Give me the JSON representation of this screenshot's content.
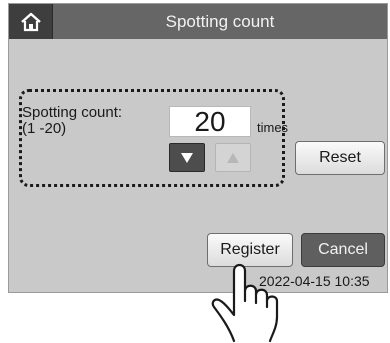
{
  "header": {
    "title": "Spotting count",
    "home_icon": "home-icon"
  },
  "setting": {
    "label": "Spotting count:",
    "range": "(1 -20)",
    "value": "20",
    "unit": "times",
    "decrement_icon": "triangle-down-icon",
    "increment_icon": "triangle-up-icon",
    "reset_label": "Reset"
  },
  "footer": {
    "register_label": "Register",
    "cancel_label": "Cancel",
    "timestamp": "2022-04-15 10:35"
  },
  "colors": {
    "titlebar": "#666666",
    "screen_bg": "#c9c9c9",
    "cancel_bg": "#5f5f5f"
  }
}
